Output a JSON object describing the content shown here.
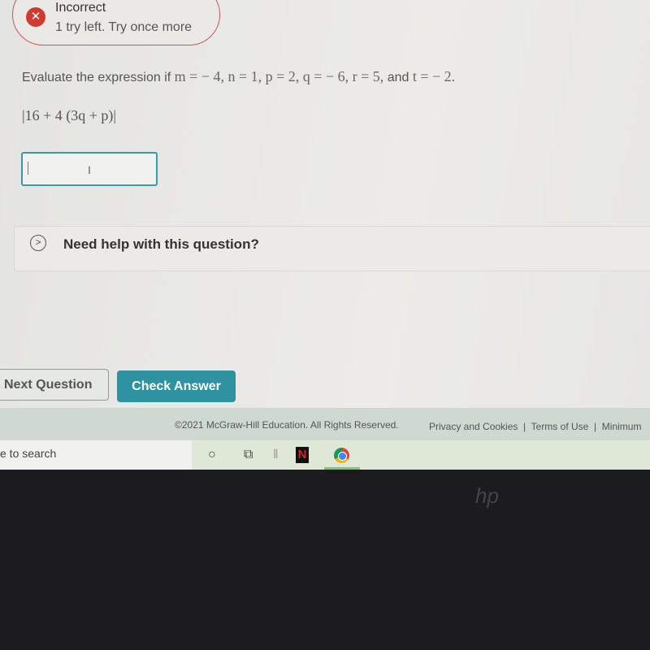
{
  "feedback": {
    "title": "Incorrect",
    "message": "1 try left. Try once more",
    "icon": "x-circle-icon"
  },
  "question": {
    "prompt": "Evaluate the expression if",
    "vars": "m = − 4, n = 1, p = 2, q = − 6, r = 5,",
    "and": "and",
    "last": "t = − 2.",
    "expression": "|16 + 4 (3q + p)|"
  },
  "answer": {
    "value": ""
  },
  "help": {
    "label": "Need help with this question?"
  },
  "buttons": {
    "next": "Next Question",
    "check": "Check Answer"
  },
  "footer": {
    "copyright": "©2021 McGraw-Hill Education. All Rights Reserved.",
    "links": [
      "Privacy and Cookies",
      "Terms of Use",
      "Minimum"
    ]
  },
  "taskbar": {
    "search": "e to search",
    "netflix": "N"
  },
  "colors": {
    "accent": "#2e92a0",
    "error": "#d23a2f"
  }
}
